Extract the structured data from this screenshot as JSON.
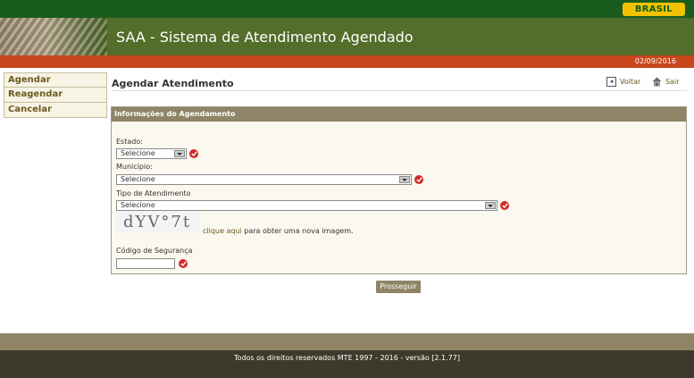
{
  "gov_bar": {
    "badge": "BRASIL"
  },
  "header": {
    "title": "SAA - Sistema de Atendimento Agendado"
  },
  "date": "02/09/2016",
  "sidebar": {
    "items": [
      {
        "label": "Agendar"
      },
      {
        "label": "Reagendar"
      },
      {
        "label": "Cancelar"
      }
    ]
  },
  "page": {
    "title": "Agendar Atendimento",
    "voltar": "Voltar",
    "sair": "Sair"
  },
  "form": {
    "section_title": "Informações do Agendamento",
    "estado": {
      "label": "Estado:",
      "value": "Selecione"
    },
    "municipio": {
      "label": "Município:",
      "value": "Selecione"
    },
    "tipo": {
      "label": "Tipo de Atendimento",
      "value": "Selecione"
    },
    "captcha": {
      "image_text": "dYV°7t",
      "link": "clique aqui",
      "link_suffix": " para obter uma nova imagem."
    },
    "codigo": {
      "label": "Código de Segurança",
      "value": ""
    },
    "submit": "Prosseguir"
  },
  "footer": {
    "text": "Todos os direitos reservados MTE 1997 - 2016 - versão [2.1.77]"
  },
  "colors": {
    "gov_green": "#1a5c1e",
    "header_green": "#536d2a",
    "orange": "#c9461c",
    "olive": "#8f8466",
    "required_red": "#d12a2a"
  }
}
